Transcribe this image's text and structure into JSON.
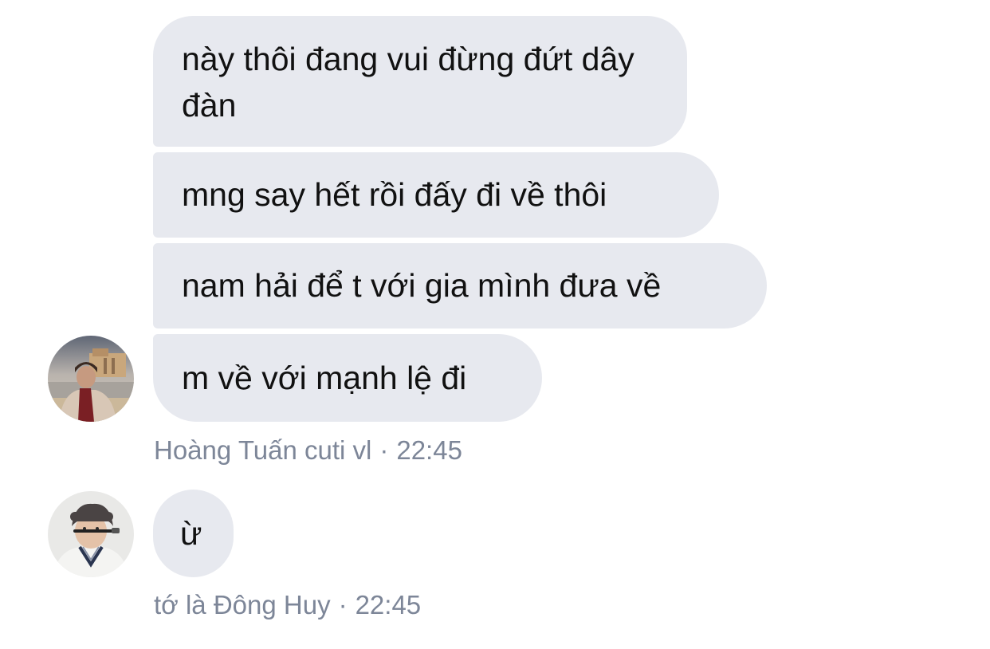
{
  "messages": [
    {
      "text": "này thôi đang vui đừng đứt dây đàn"
    },
    {
      "text": "mng say hết rồi đấy đi về thôi"
    },
    {
      "text": "nam hải để t với gia mình đưa về"
    },
    {
      "text": "m về với mạnh lệ đi"
    },
    {
      "text": "ừ"
    }
  ],
  "groups": [
    {
      "sender": "Hoàng Tuấn cuti vl",
      "separator": "·",
      "time": "22:45",
      "avatar_icon": "avatar-photo-icon"
    },
    {
      "sender": "tớ là Đông Huy",
      "separator": "·",
      "time": "22:45",
      "avatar_icon": "avatar-photo-icon"
    }
  ],
  "colors": {
    "bubble_background": "#e7e9ef",
    "meta_text": "#7d8698",
    "message_text": "#111111"
  }
}
